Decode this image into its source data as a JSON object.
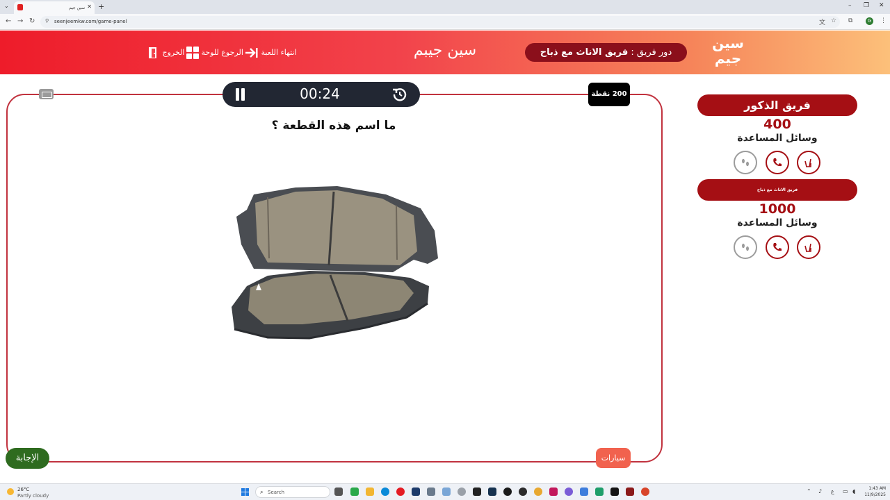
{
  "browser": {
    "tab_title": "سين جيم",
    "url": "seenjeemkw.com/game-panel",
    "profile_initial": "G"
  },
  "header": {
    "logo_line1": "سين",
    "logo_line2": "جيم",
    "turn_prefix": "دور فريق :",
    "turn_team": "فريق الاناث مع ذباح",
    "site_title": "سين جيبم",
    "end_game": "انتهاء اللعبة",
    "back_to_board": "الرجوع للوحة",
    "exit": "الخروج"
  },
  "game": {
    "timer": "00:24",
    "points": "200 نقطة",
    "question": "ما اسم هذه القطعة ؟",
    "image_subject": "brake-pads",
    "category": "سيارات",
    "answer_button": "الإجابة"
  },
  "teams": [
    {
      "name": "فريق الذكور",
      "score": "400",
      "aids_label": "وسائل المساعدة",
      "aids": [
        {
          "icon": "two-fingers-icon",
          "enabled": true
        },
        {
          "icon": "phone-icon",
          "enabled": true
        },
        {
          "icon": "footsteps-icon",
          "enabled": false
        }
      ]
    },
    {
      "name": "فريق الاناث مع ذباح",
      "score": "1000",
      "aids_label": "وسائل المساعدة",
      "aids": [
        {
          "icon": "two-fingers-icon",
          "enabled": true
        },
        {
          "icon": "phone-icon",
          "enabled": true
        },
        {
          "icon": "footsteps-icon",
          "enabled": false
        }
      ]
    }
  ],
  "taskbar": {
    "weather_temp": "26°C",
    "weather_desc": "Partly cloudy",
    "search_placeholder": "Search",
    "time": "1:43 AM",
    "date": "11/9/2025"
  },
  "colors": {
    "accent": "#a50f14",
    "header_start": "#ee1c2a",
    "header_end": "#fcc07a",
    "panel_border": "#c1323e",
    "answer": "#2e6b1f",
    "category": "#f1624e"
  }
}
